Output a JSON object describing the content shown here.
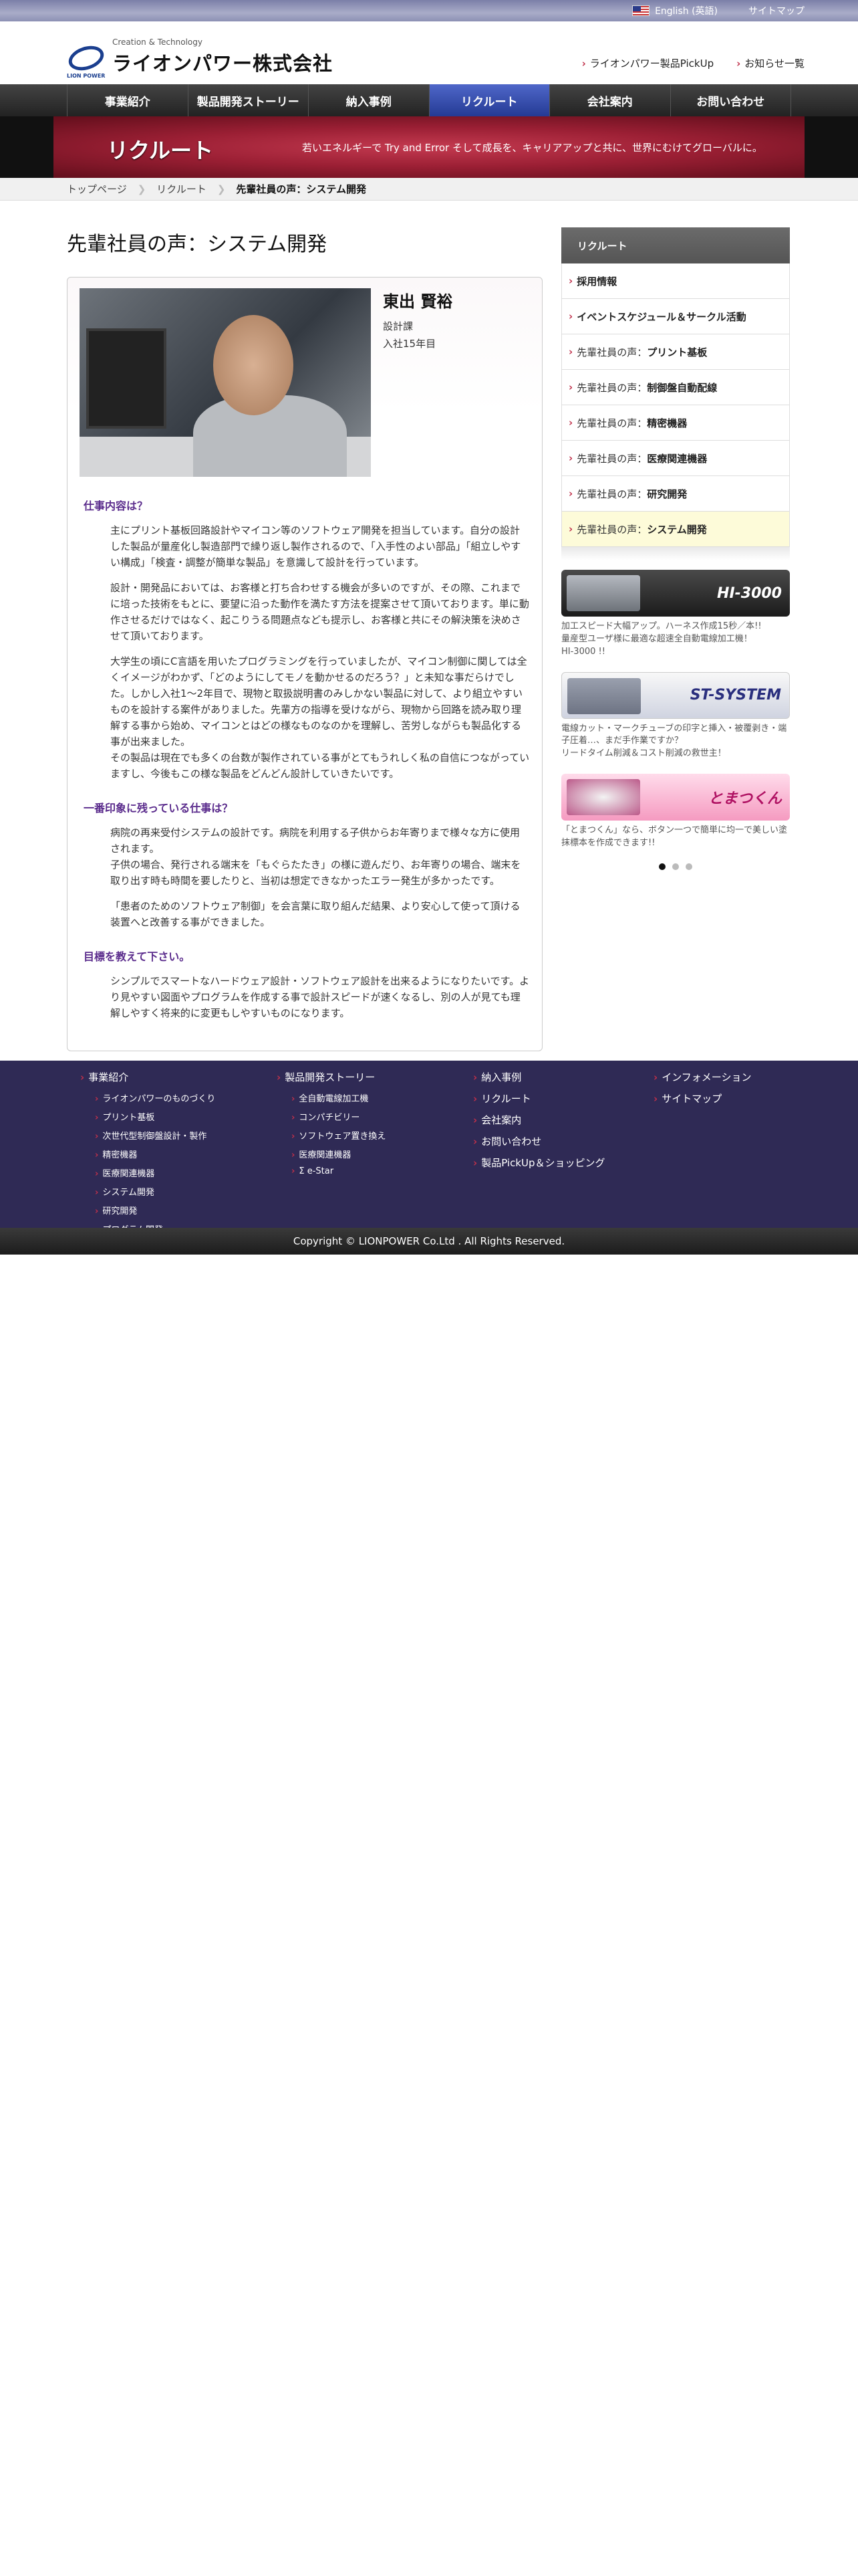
{
  "topbar": {
    "english": "English (英語)",
    "sitemap": "サイトマップ"
  },
  "header": {
    "tagline": "Creation & Technology",
    "logo_sub": "LION POWER",
    "company": "ライオンパワー株式会社",
    "links": [
      "ライオンパワー製品PickUp",
      "お知らせ一覧"
    ]
  },
  "nav": [
    "事業紹介",
    "製品開発ストーリー",
    "納入事例",
    "リクルート",
    "会社案内",
    "お問い合わせ"
  ],
  "banner": {
    "title": "リクルート",
    "subtitle": "若いエネルギーで Try and Error そして成長を、キャリアアップと共に、世界にむけてグローバルに。"
  },
  "breadcrumb": [
    "トップページ",
    "リクルート",
    "先輩社員の声：システム開発"
  ],
  "page": {
    "title": "先輩社員の声：システム開発",
    "person": {
      "name": "東出 賢裕",
      "dept": "設計課",
      "years": "入社15年目"
    },
    "sections": [
      {
        "heading": "仕事内容は？",
        "paras": [
          "主にプリント基板回路設計やマイコン等のソフトウェア開発を担当しています。自分の設計した製品が量産化し製造部門で繰り返し製作されるので、「入手性のよい部品」「組立しやすい構成」「検査・調整が簡単な製品」を意識して設計を行っています。",
          "設計・開発品においては、お客様と打ち合わせする機会が多いのですが、その際、これまでに培った技術をもとに、要望に沿った動作を満たす方法を提案させて頂いております。単に動作させるだけではなく、起こりうる問題点なども提示し、お客様と共にその解決策を決めさせて頂いております。",
          "大学生の頃にC言語を用いたプログラミングを行っていましたが、マイコン制御に関しては全くイメージがわかず、「どのようにしてモノを動かせるのだろう？」と未知な事だらけでした。しかし入社1〜2年目で、現物と取扱説明書のみしかない製品に対して、より組立やすいものを設計する案件がありました。先輩方の指導を受けながら、現物から回路を読み取り理解する事から始め、マイコンとはどの様なものなのかを理解し、苦労しながらも製品化する事が出来ました。\nその製品は現在でも多くの台数が製作されている事がとてもうれしく私の自信につながっていますし、今後もこの様な製品をどんどん設計していきたいです。"
        ]
      },
      {
        "heading": "一番印象に残っている仕事は？",
        "paras": [
          "病院の再来受付システムの設計です。病院を利用する子供からお年寄りまで様々な方に使用されます。\n子供の場合、発行される端末を「もぐらたたき」の様に遊んだり、お年寄りの場合、端末を取り出す時も時間を要したりと、当初は想定できなかったエラー発生が多かったです。",
          "「患者のためのソフトウェア制御」を会言葉に取り組んだ結果、より安心して使って頂ける装置へと改善する事ができました。"
        ]
      },
      {
        "heading": "目標を教えて下さい。",
        "paras": [
          "シンプルでスマートなハードウェア設計・ソフトウェア設計を出来るようになりたいです。より見やすい図面やプログラムを作成する事で設計スピードが速くなるし、別の人が見ても理解しやすく将来的に変更もしやすいものになります。"
        ]
      }
    ]
  },
  "sidebar": {
    "title": "リクルート",
    "items": [
      {
        "prefix": "",
        "label": "採用情報"
      },
      {
        "prefix": "",
        "label": "イベントスケジュール＆サークル活動"
      },
      {
        "prefix": "先輩社員の声：",
        "label": "プリント基板"
      },
      {
        "prefix": "先輩社員の声：",
        "label": "制御盤自動配線"
      },
      {
        "prefix": "先輩社員の声：",
        "label": "精密機器"
      },
      {
        "prefix": "先輩社員の声：",
        "label": "医療関連機器"
      },
      {
        "prefix": "先輩社員の声：",
        "label": "研究開発"
      },
      {
        "prefix": "先輩社員の声：",
        "label": "システム開発"
      }
    ],
    "ads": [
      {
        "title": "HI-3000",
        "text": "加工スピード大幅アップ。ハーネス作成15秒／本!!\n量産型ユーザ様に最適な超速全自動電線加工機！\nHI-3000 !!"
      },
      {
        "title": "ST-SYSTEM",
        "text": "電線カット・マークチューブの印字と挿入・被覆剥き・端子圧着…、まだ手作業ですか？\nリードタイム削減＆コスト削減の救世主！"
      },
      {
        "title": "とまつくん",
        "text": "「とまつくん」なら、ボタン一つで簡単に均一で美しい塗抹標本を作成できます!!"
      }
    ]
  },
  "footer": {
    "col1": {
      "head": "事業紹介",
      "subs": [
        "ライオンパワーのものづくり",
        "プリント基板",
        "次世代型制御盤設計・製作",
        "精密機器",
        "医療関連機器",
        "システム開発",
        "研究開発",
        "プログラム開発"
      ]
    },
    "col2": {
      "head": "製品開発ストーリー",
      "subs": [
        "全自動電線加工機",
        "コンパチビリー",
        "ソフトウェア置き換え",
        "医療関連機器",
        "Σ e-Star"
      ]
    },
    "col3": [
      "納入事例",
      "リクルート",
      "会社案内",
      "お問い合わせ",
      "製品PickUp＆ショッピング"
    ],
    "col4": [
      "インフォメーション",
      "サイトマップ"
    ],
    "copyright": "Copyright © LIONPOWER Co.Ltd . All Rights Reserved."
  }
}
